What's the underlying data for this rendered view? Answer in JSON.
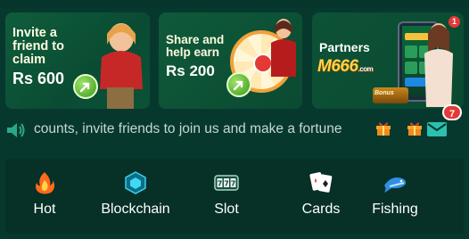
{
  "banners": [
    {
      "text_lines": [
        "Invite a",
        "friend to",
        "claim"
      ],
      "amount": "Rs 600"
    },
    {
      "text_lines": [
        "Share and",
        "help earn"
      ],
      "amount": "Rs 200"
    },
    {
      "title": "Partners",
      "brand": "M666",
      "brand_suffix": ".com",
      "notification_count": "1",
      "chest_label": "Bonus"
    }
  ],
  "announcement": {
    "text": "counts, invite friends to join us and make a fortune",
    "mail_badge": "7"
  },
  "categories": [
    {
      "label": "Hot",
      "icon": "fire-icon"
    },
    {
      "label": "Blockchain",
      "icon": "blockchain-icon"
    },
    {
      "label": "Slot",
      "icon": "slot-777-icon"
    },
    {
      "label": "Cards",
      "icon": "playing-cards-icon"
    },
    {
      "label": "Fishing",
      "icon": "fish-icon"
    }
  ],
  "colors": {
    "background": "#07382e",
    "banner_green": "#0b5236",
    "accent_yellow": "#ffd54a",
    "badge_red": "#e53935",
    "mail_blue": "#2cc0b0"
  }
}
